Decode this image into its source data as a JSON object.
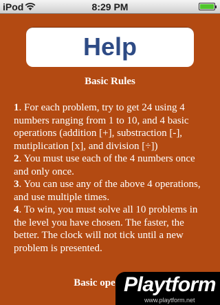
{
  "status_bar": {
    "carrier": "iPod",
    "time": "8:29 PM"
  },
  "help_button_label": "Help",
  "basic_rules": {
    "title": "Basic Rules",
    "items": [
      {
        "num": "1",
        "text": ". For each problem, try to get 24 using 4 numbers ranging from 1 to 10, and 4 basic operations (addition [+], substraction [-], mutiplication [x], and division [÷])"
      },
      {
        "num": "2",
        "text": ". You must use each of the 4 numbers once and only once."
      },
      {
        "num": "3",
        "text": ". You can use any of the above 4 operations, and use multiple times."
      },
      {
        "num": "4",
        "text": ". To win, you must solve all 10 problems in the level you have chosen. The faster, the better. The clock will not tick until a new problem is presented."
      }
    ]
  },
  "next_section_title": "Basic operations",
  "watermark": {
    "brand": "Playtform",
    "url": "www.playtform.net"
  }
}
